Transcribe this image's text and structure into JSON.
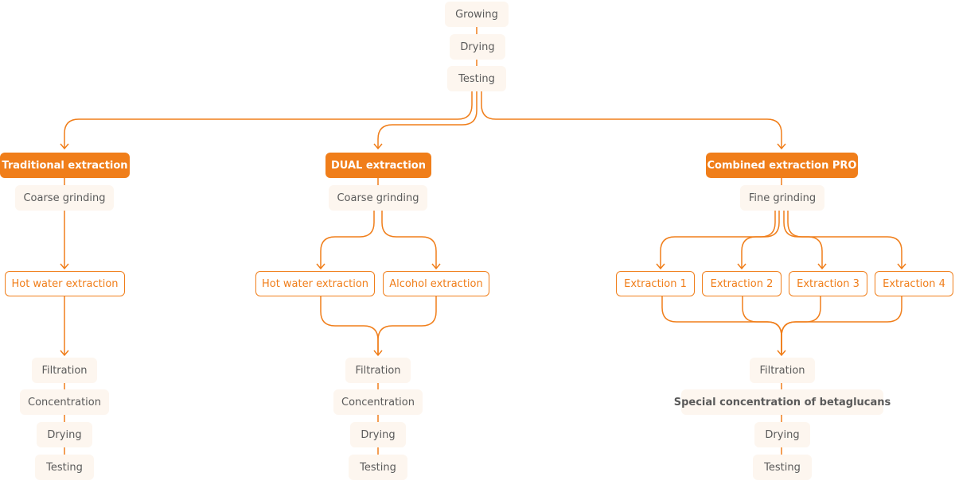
{
  "colors": {
    "accent": "#f07e1a",
    "step_bg": "#fdf6ef",
    "text": "#5a5a5a"
  },
  "top": [
    "Growing",
    "Drying",
    "Testing"
  ],
  "traditional": {
    "title": "Traditional extraction",
    "grinding": "Coarse grinding",
    "extractions": [
      "Hot water extraction"
    ],
    "steps": [
      "Filtration",
      "Concentration",
      "Drying",
      "Testing"
    ]
  },
  "dual": {
    "title": "DUAL extraction",
    "grinding": "Coarse grinding",
    "extractions": [
      "Hot water extraction",
      "Alcohol extraction"
    ],
    "steps": [
      "Filtration",
      "Concentration",
      "Drying",
      "Testing"
    ]
  },
  "combined": {
    "title": "Combined extraction PRO",
    "grinding": "Fine grinding",
    "extractions": [
      "Extraction 1",
      "Extraction 2",
      "Extraction 3",
      "Extraction 4"
    ],
    "steps": [
      "Filtration",
      "Special concentration of betaglucans",
      "Drying",
      "Testing"
    ]
  }
}
